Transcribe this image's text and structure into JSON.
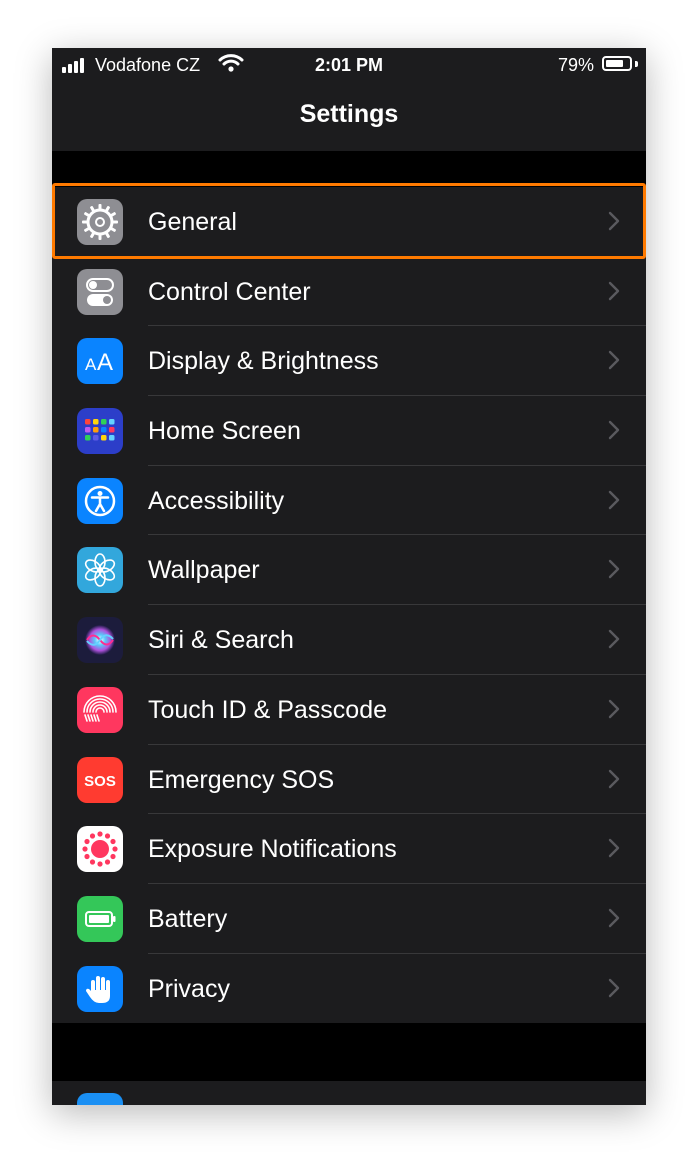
{
  "status_bar": {
    "carrier": "Vodafone CZ",
    "time": "2:01 PM",
    "battery_percent": "79%",
    "battery_level": 0.79
  },
  "nav": {
    "title": "Settings"
  },
  "settings": [
    {
      "label": "General",
      "icon": "gear-icon",
      "color": "#8e8e93",
      "highlighted": true
    },
    {
      "label": "Control Center",
      "icon": "toggles-icon",
      "color": "#8e8e93"
    },
    {
      "label": "Display & Brightness",
      "icon": "text-size-icon",
      "color": "#0a84ff"
    },
    {
      "label": "Home Screen",
      "icon": "app-grid-icon",
      "color": "#2c3ec9"
    },
    {
      "label": "Accessibility",
      "icon": "accessibility-icon",
      "color": "#0a84ff"
    },
    {
      "label": "Wallpaper",
      "icon": "flower-icon",
      "color": "#32a7dc"
    },
    {
      "label": "Siri & Search",
      "icon": "siri-icon",
      "color": "#1c1c3c"
    },
    {
      "label": "Touch ID & Passcode",
      "icon": "fingerprint-icon",
      "color": "#ff375f"
    },
    {
      "label": "Emergency SOS",
      "icon": "sos-icon",
      "color": "#ff3b30",
      "icon_text": "SOS"
    },
    {
      "label": "Exposure Notifications",
      "icon": "exposure-icon",
      "color": "#ffffff"
    },
    {
      "label": "Battery",
      "icon": "battery-icon",
      "color": "#34c759"
    },
    {
      "label": "Privacy",
      "icon": "hand-icon",
      "color": "#0a84ff"
    }
  ],
  "colors": {
    "highlight": "#ff7a00",
    "background": "#000000",
    "group": "#1c1c1e",
    "separator": "#38383a"
  }
}
